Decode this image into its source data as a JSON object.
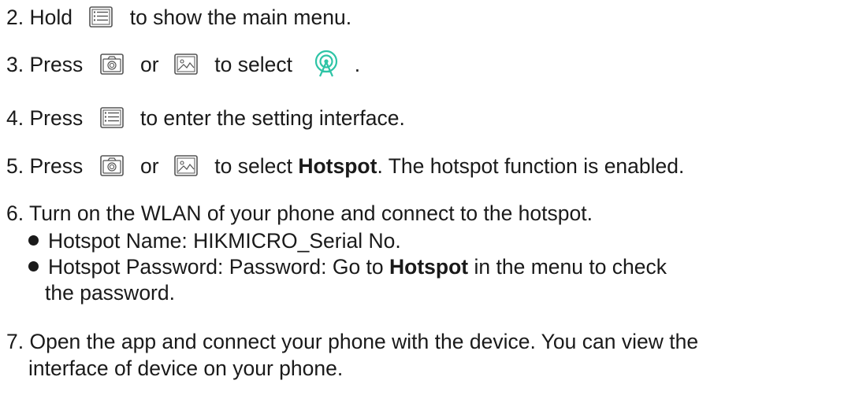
{
  "steps": {
    "s2": {
      "prefix": "2. Hold",
      "suffix": "to show the main menu."
    },
    "s3": {
      "prefix": "3. Press",
      "or": "or",
      "middle": "to select",
      "suffix": "."
    },
    "s4": {
      "prefix": "4. Press",
      "suffix": "to enter the setting interface."
    },
    "s5": {
      "prefix": "5. Press",
      "or": "or",
      "middle": "to select",
      "bold": "Hotspot",
      "suffix": ". The hotspot function is enabled."
    },
    "s6": {
      "text": "6. Turn on the WLAN of your phone and connect to the hotspot.",
      "bullet1": "Hotspot Name: HIKMICRO_Serial No.",
      "bullet2_prefix": "Hotspot Password: Password: Go to",
      "bullet2_bold": "Hotspot",
      "bullet2_suffix": "in the menu to check",
      "bullet2_cont": "the password."
    },
    "s7": {
      "line1": "7. Open the app and connect your phone with the device. You can view the",
      "line2": "interface of device on your phone."
    }
  },
  "icons": {
    "menu": "menu-list-icon",
    "camera": "camera-icon",
    "image": "image-icon",
    "hotspot": "hotspot-icon"
  },
  "colors": {
    "text": "#1a1a1a",
    "icon_outline": "#555555",
    "hotspot": "#2ec4a6"
  }
}
